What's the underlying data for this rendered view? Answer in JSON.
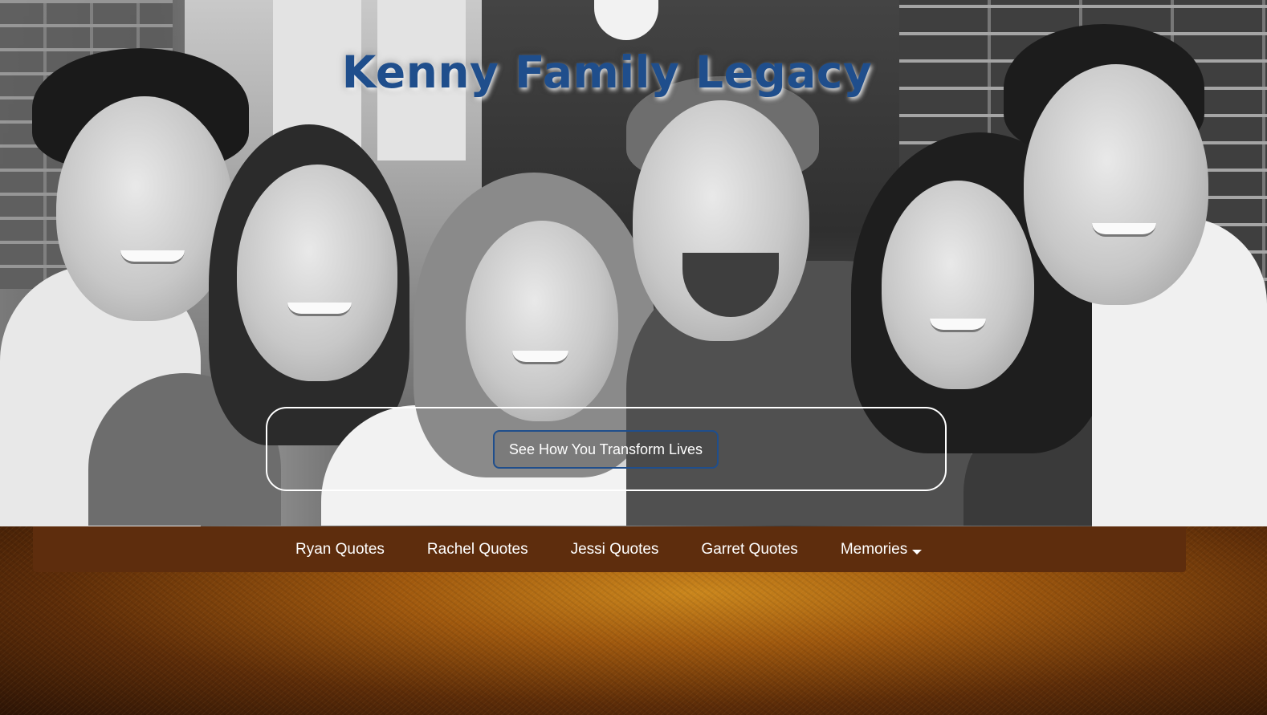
{
  "site": {
    "title": "Kenny Family Legacy"
  },
  "hero": {
    "cta_label": "See How You Transform Lives"
  },
  "nav": {
    "items": [
      {
        "label": "Ryan Quotes"
      },
      {
        "label": "Rachel Quotes"
      },
      {
        "label": "Jessi Quotes"
      },
      {
        "label": "Garret Quotes"
      },
      {
        "label": "Memories",
        "has_dropdown": true
      }
    ]
  },
  "colors": {
    "title_blue": "#1f4e8c",
    "nav_brown": "#5e2d0d",
    "cta_border": "#1f4e8c"
  },
  "icons": {
    "memories_dropdown": "caret-down-icon"
  }
}
